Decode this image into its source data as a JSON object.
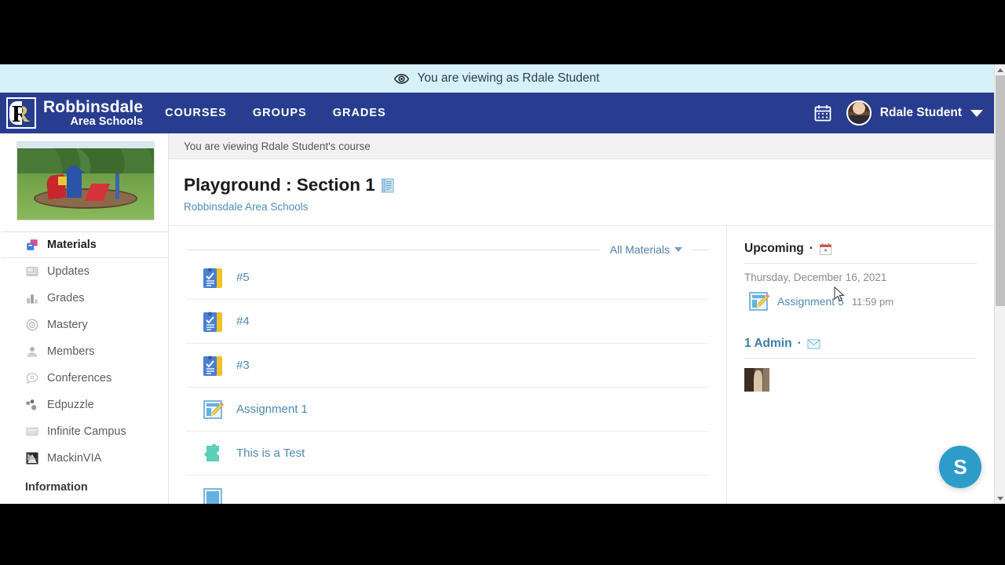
{
  "masquerade": {
    "icon": "eye-icon",
    "text": "You are viewing as Rdale Student"
  },
  "topnav": {
    "brand": {
      "line1": "Robbinsdale",
      "line2": "Area Schools",
      "mark_letter": "R"
    },
    "links": [
      {
        "label": "COURSES"
      },
      {
        "label": "GROUPS"
      },
      {
        "label": "GRADES"
      }
    ],
    "calendar_icon": "calendar-icon",
    "user": {
      "name": "Rdale Student",
      "avatar": "user-avatar",
      "caret": "chevron-down-icon"
    },
    "bg_color": "#283d8f"
  },
  "viewing_bar": {
    "text": "You are viewing Rdale Student's course"
  },
  "course": {
    "thumbnail_alt": "playground-photo",
    "title": "Playground : Section 1",
    "title_icon": "course-notebook-icon",
    "organization": "Robbinsdale Area Schools"
  },
  "sidebar": {
    "items": [
      {
        "label": "Materials",
        "icon": "materials-icon",
        "active": true
      },
      {
        "label": "Updates",
        "icon": "updates-icon",
        "active": false
      },
      {
        "label": "Grades",
        "icon": "grades-bar-chart-icon",
        "active": false
      },
      {
        "label": "Mastery",
        "icon": "mastery-target-icon",
        "active": false
      },
      {
        "label": "Members",
        "icon": "members-person-icon",
        "active": false
      },
      {
        "label": "Conferences",
        "icon": "conferences-chat-icon",
        "active": false
      },
      {
        "label": "Edpuzzle",
        "icon": "edpuzzle-icon",
        "active": false
      },
      {
        "label": "Infinite Campus",
        "icon": "infinite-campus-icon",
        "active": false
      },
      {
        "label": "MackinVIA",
        "icon": "mackinvia-icon",
        "active": false
      }
    ],
    "section_label": "Information"
  },
  "materials": {
    "filter_label": "All Materials",
    "filter_caret": "chevron-down-icon",
    "items": [
      {
        "label": "#5",
        "icon": "quiz-clipboard-icon"
      },
      {
        "label": "#4",
        "icon": "quiz-clipboard-icon"
      },
      {
        "label": "#3",
        "icon": "quiz-clipboard-icon"
      },
      {
        "label": "Assignment 1",
        "icon": "assignment-pencil-icon"
      },
      {
        "label": "This is a Test",
        "icon": "puzzle-piece-icon"
      }
    ]
  },
  "upcoming": {
    "heading": "Upcoming",
    "separator": "·",
    "icon": "calendar-small-icon",
    "date": "Thursday, December 16, 2021",
    "events": [
      {
        "name": "Assignment 5",
        "time": "11:59 pm",
        "icon": "assignment-pencil-icon"
      }
    ]
  },
  "admins": {
    "heading": "1 Admin",
    "separator": "·",
    "mail_icon": "envelope-icon",
    "avatars": [
      {
        "alt": "admin-avatar"
      }
    ]
  },
  "support": {
    "label": "S"
  },
  "scrollbar": {
    "up_icon": "scroll-up-arrow-icon",
    "down_icon": "scroll-down-arrow-icon"
  }
}
